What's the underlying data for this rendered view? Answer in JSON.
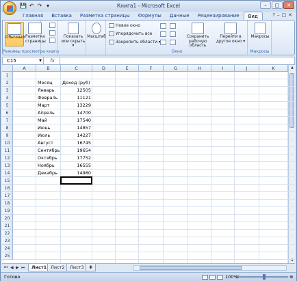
{
  "window": {
    "title": "Книга1 - Microsoft Excel",
    "controls": [
      "–",
      "□",
      "✕"
    ]
  },
  "qat": [
    "💾",
    "↶",
    "↷",
    "▾"
  ],
  "tabs": [
    "Главная",
    "Вставка",
    "Разметка страницы",
    "Формулы",
    "Данные",
    "Рецензирование",
    "Вид"
  ],
  "active_tab": "Вид",
  "ribbon": {
    "group1": {
      "label": "Режимы просмотра книги",
      "btn_normal": "Обычный",
      "btn_pagelayout": "Разметка страницы"
    },
    "group2": {
      "btn_show": "Показать или скрыть ▾"
    },
    "group3": {
      "btn_zoom": "Масштаб"
    },
    "group4": {
      "label": "Окно",
      "new_window": "Новое окно",
      "arrange_all": "Упорядочить все",
      "freeze_panes": "Закрепить области ▾",
      "save_workspace": "Сохранить рабочую область",
      "switch_windows": "Перейти в другое окно ▾"
    },
    "group5": {
      "label": "Макросы",
      "btn_macros": "Макросы"
    }
  },
  "formula_bar": {
    "name_box": "C15",
    "fx": "fx",
    "content": ""
  },
  "columns": [
    "A",
    "B",
    "C",
    "D",
    "E",
    "F",
    "G",
    "H",
    "I",
    "J",
    "K"
  ],
  "rows": [
    "1",
    "2",
    "3",
    "4",
    "5",
    "6",
    "7",
    "8",
    "9",
    "10",
    "11",
    "12",
    "13",
    "14",
    "15",
    "16",
    "17",
    "18",
    "19",
    "20",
    "21",
    "22",
    "23",
    "24",
    "25"
  ],
  "table": {
    "header_month": "Месяц",
    "header_income": "Доход (руб)",
    "months": [
      "Январь",
      "Февраль",
      "Март",
      "Апрель",
      "Май",
      "Июнь",
      "Июль",
      "Август",
      "Сентябрь",
      "Октябрь",
      "Ноябрь",
      "Декабрь"
    ],
    "values": [
      "12505",
      "11121",
      "13229",
      "14700",
      "17540",
      "14857",
      "14227",
      "16745",
      "19654",
      "17752",
      "16555",
      "14980"
    ]
  },
  "sheets": [
    "Лист1",
    "Лист2",
    "Лист3"
  ],
  "active_sheet": "Лист1",
  "status": {
    "ready": "Готово",
    "zoom": "100%"
  }
}
